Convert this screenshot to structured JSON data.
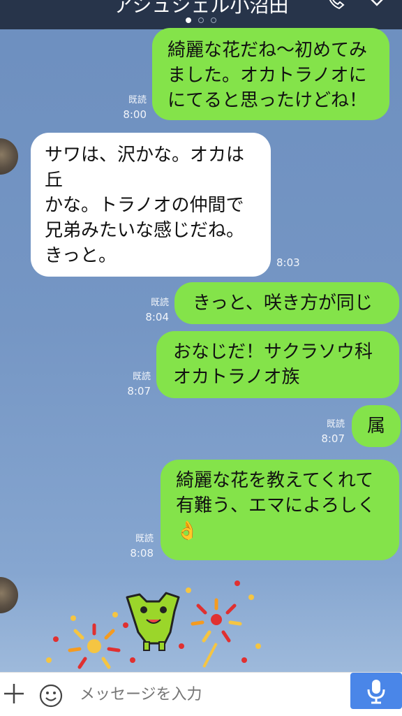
{
  "header": {
    "title": "アシュシェル小沼田",
    "page_count": 3,
    "active_page": 1
  },
  "messages": [
    {
      "side": "right",
      "text": [
        "綺麗な花だね〜初めてみ",
        "ました。オカトラノオに",
        "にてると思ったけどね！"
      ],
      "read": "既読",
      "time": "8:00"
    },
    {
      "side": "left",
      "text": [
        "サワは、沢かな。オカは",
        "丘",
        "かな。トラノオの仲間で",
        "兄弟みたいな感じだね。",
        "きっと。"
      ],
      "time": "8:03"
    },
    {
      "side": "right",
      "text": [
        "きっと、咲き方が同じ"
      ],
      "read": "既読",
      "time": "8:04"
    },
    {
      "side": "right",
      "text": [
        "おなじだ！サクラソウ科",
        "オカトラノオ族"
      ],
      "read": "既読",
      "time": "8:07"
    },
    {
      "side": "right",
      "text": [
        "属"
      ],
      "read": "既読",
      "time": "8:07"
    },
    {
      "side": "right",
      "text": [
        "綺麗な花を教えてくれて",
        "有難う、エマによろしく",
        "👌"
      ],
      "read": "既読",
      "time": "8:08"
    }
  ],
  "input": {
    "placeholder": "メッセージを入力"
  },
  "icons": {
    "call": "phone-icon",
    "chevron": "chevron-down-icon",
    "plus": "plus-icon",
    "emoji": "smiley-icon",
    "mic": "microphone-icon",
    "sticker": "fireworks-frog-sticker"
  },
  "colors": {
    "header_bg": "#27344a",
    "bubble_sent": "#84e34a",
    "bubble_received": "#ffffff",
    "mic_button": "#4a86e8"
  }
}
